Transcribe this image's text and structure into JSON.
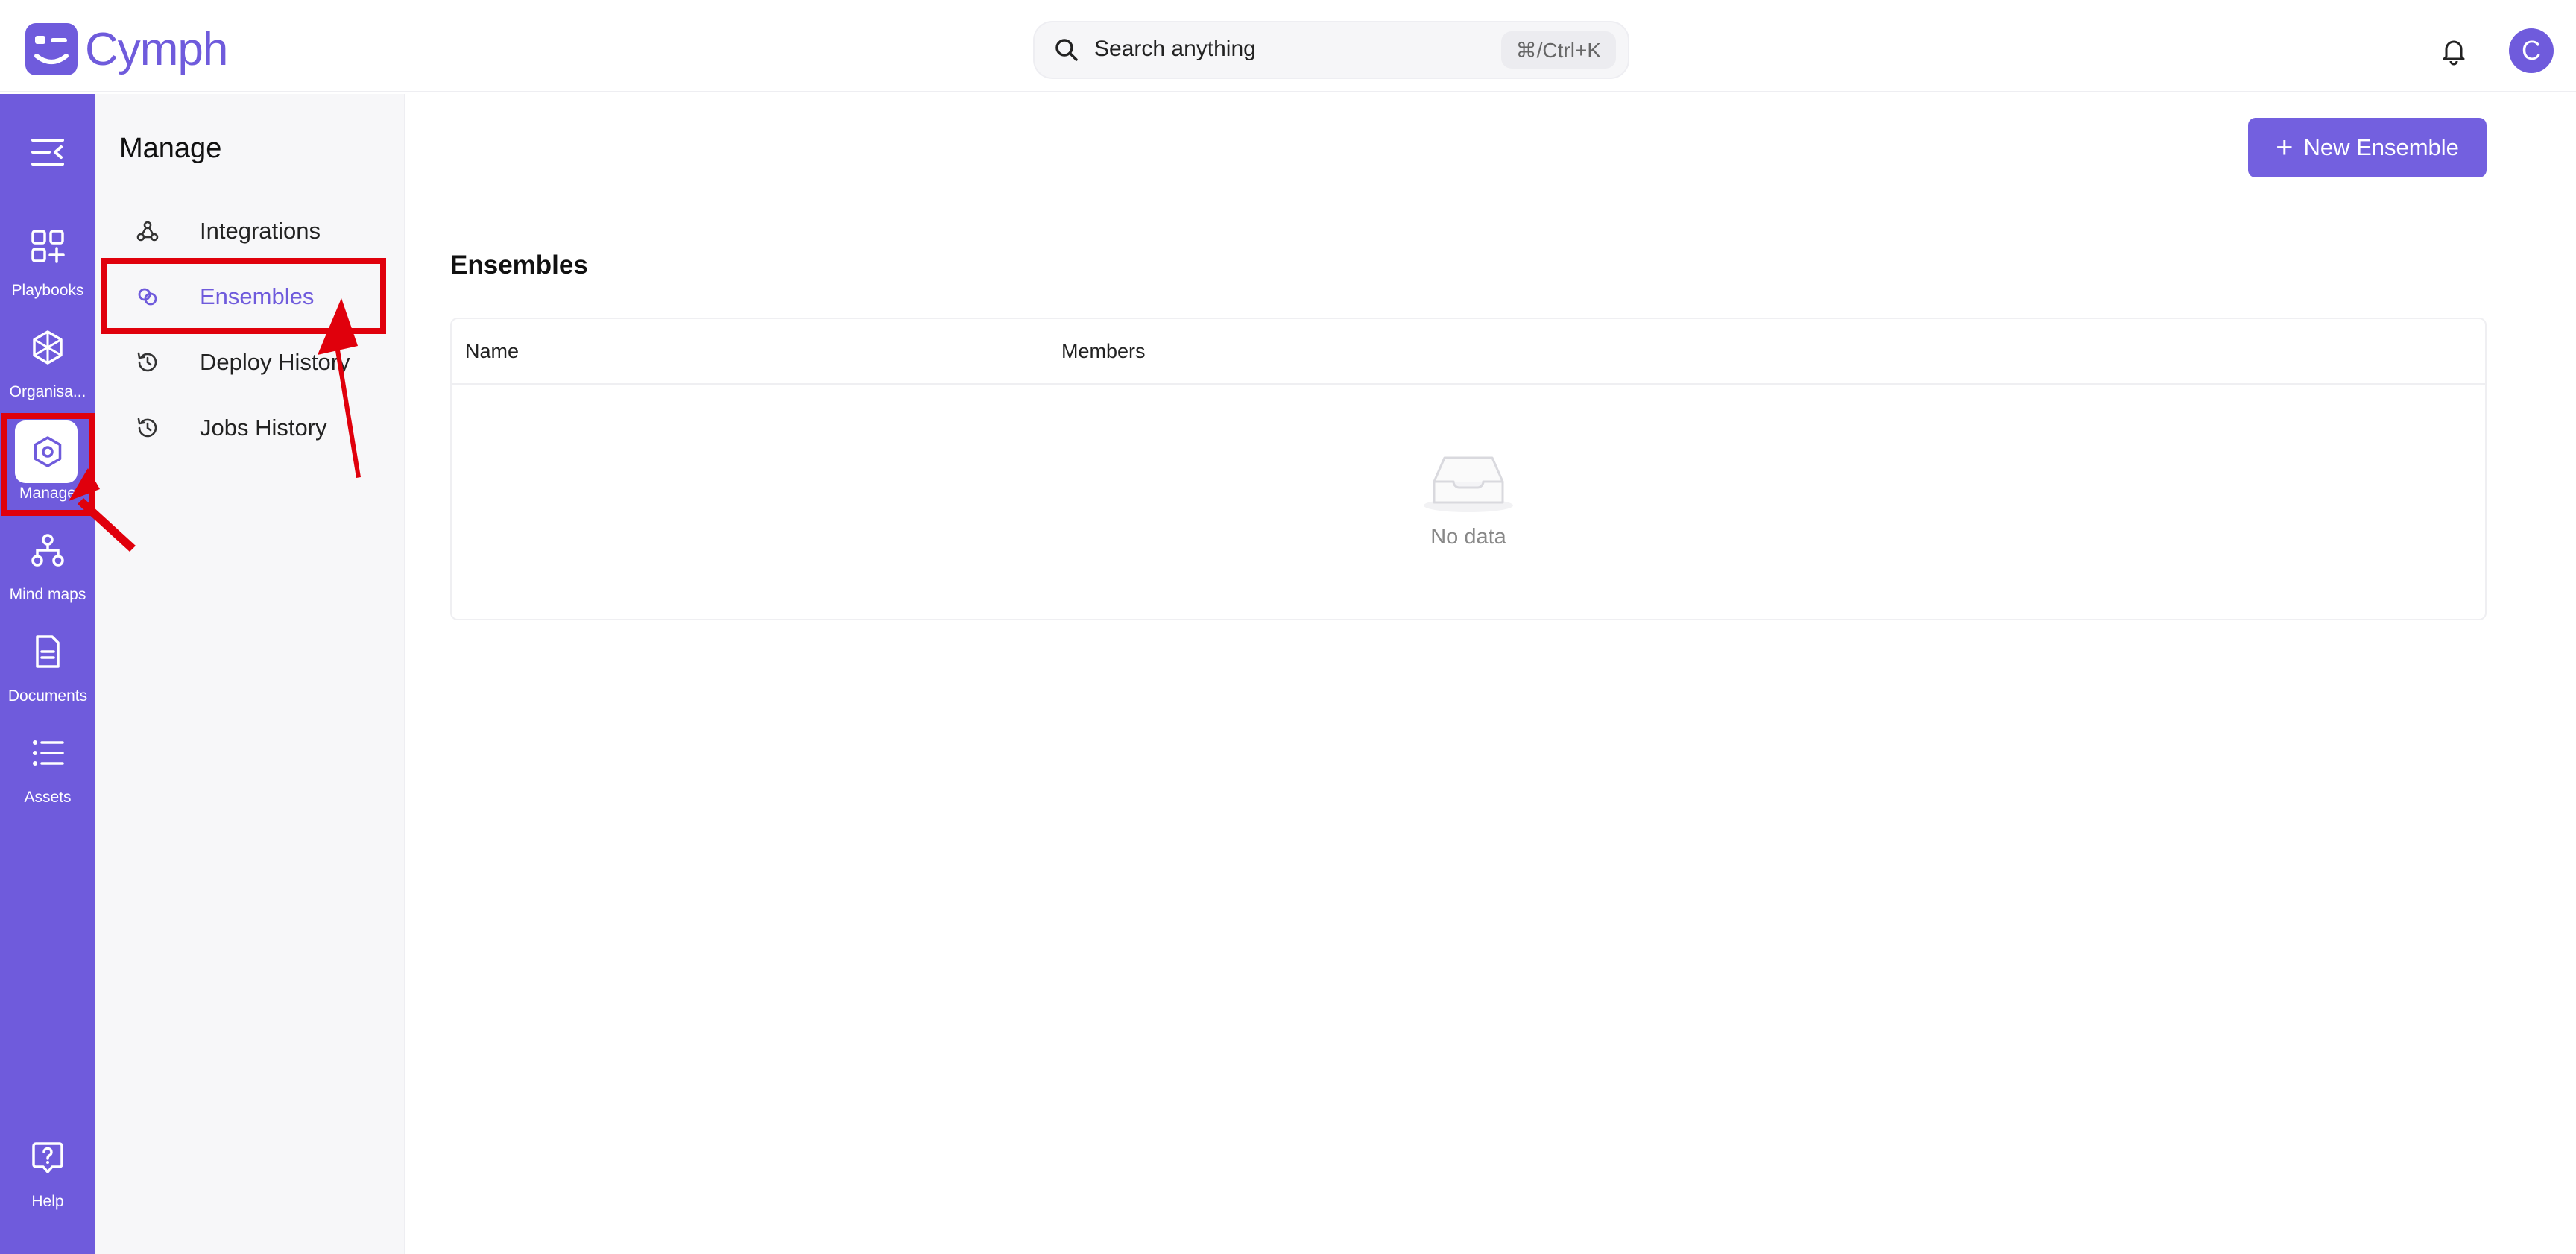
{
  "app": {
    "name": "Cymph"
  },
  "search": {
    "placeholder": "Search anything",
    "shortcut": "⌘/Ctrl+K"
  },
  "user": {
    "avatar_initial": "C"
  },
  "rail": {
    "items": [
      {
        "label": "Playbooks",
        "icon": "playbooks-icon"
      },
      {
        "label": "Organisa...",
        "icon": "organisation-icon"
      },
      {
        "label": "Manage",
        "icon": "manage-icon",
        "active": true
      },
      {
        "label": "Mind maps",
        "icon": "mind-maps-icon"
      },
      {
        "label": "Documents",
        "icon": "documents-icon"
      },
      {
        "label": "Assets",
        "icon": "assets-icon"
      }
    ],
    "help_label": "Help"
  },
  "subnav": {
    "title": "Manage",
    "items": [
      {
        "label": "Integrations",
        "icon": "webhook-icon"
      },
      {
        "label": "Ensembles",
        "icon": "link-icon",
        "active": true
      },
      {
        "label": "Deploy History",
        "icon": "history-icon"
      },
      {
        "label": "Jobs History",
        "icon": "history-icon"
      }
    ]
  },
  "main": {
    "new_button_label": "New Ensemble",
    "section_title": "Ensembles",
    "table": {
      "columns": [
        "Name",
        "Members"
      ],
      "rows": [],
      "empty_text": "No data"
    }
  },
  "colors": {
    "brand": "#6f5bdc",
    "annotation": "#e0000c"
  }
}
